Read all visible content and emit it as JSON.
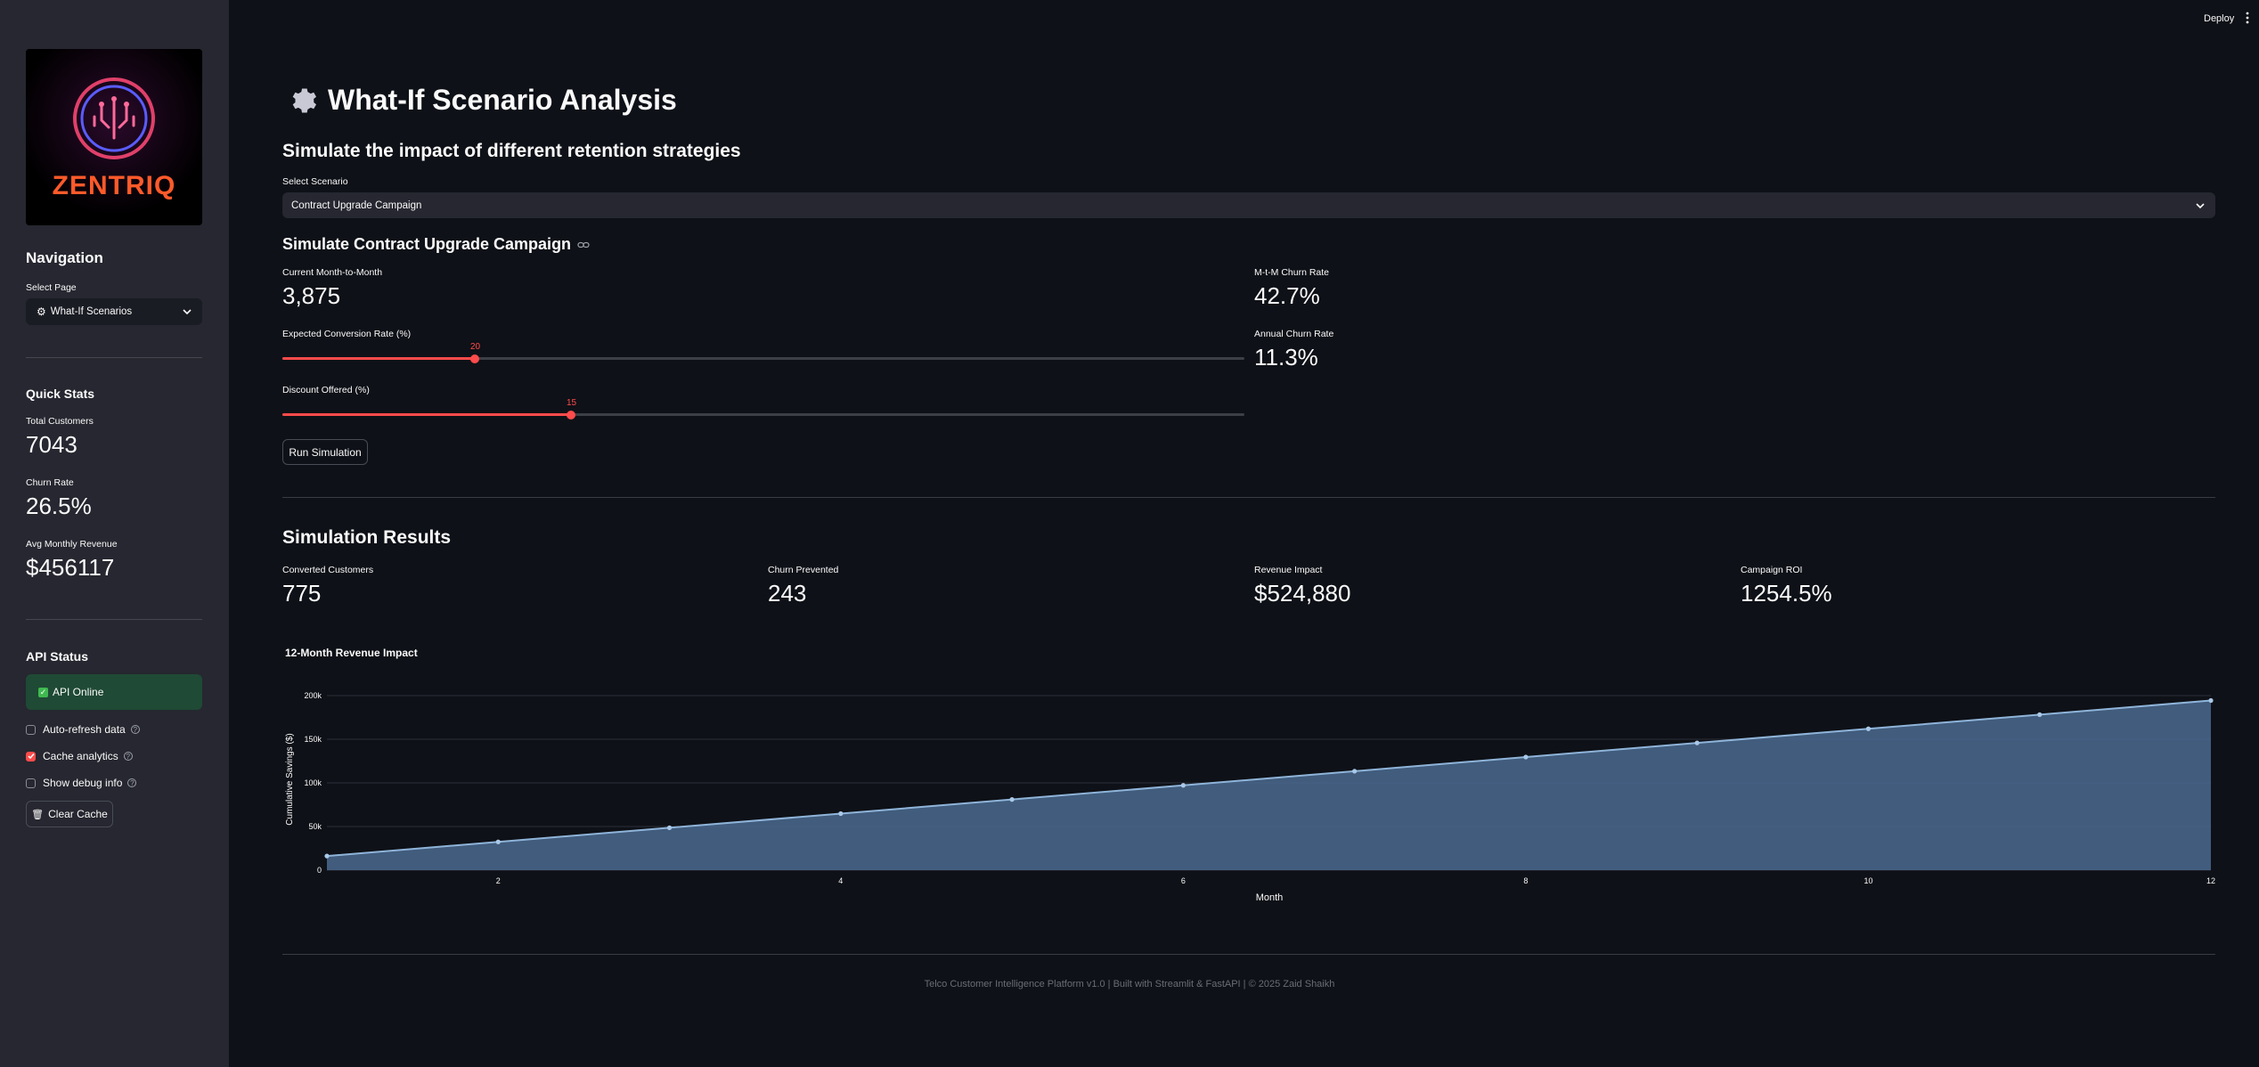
{
  "topbar": {
    "deploy_label": "Deploy"
  },
  "sidebar": {
    "logo_text": "ZENTRIQ",
    "navigation_heading": "Navigation",
    "select_page_label": "Select Page",
    "select_page_value": "What-If Scenarios",
    "quick_stats_heading": "Quick Stats",
    "stats": [
      {
        "label": "Total Customers",
        "value": "7043"
      },
      {
        "label": "Churn Rate",
        "value": "26.5%"
      },
      {
        "label": "Avg Monthly Revenue",
        "value": "$456117"
      }
    ],
    "api_status_heading": "API Status",
    "api_status_text": "API Online",
    "checkboxes": [
      {
        "label": "Auto-refresh data",
        "checked": false
      },
      {
        "label": "Cache analytics",
        "checked": true
      },
      {
        "label": "Show debug info",
        "checked": false
      }
    ],
    "clear_cache_label": "Clear Cache"
  },
  "main": {
    "title": "What-If Scenario Analysis",
    "subtitle": "Simulate the impact of different retention strategies",
    "scenario_label": "Select Scenario",
    "scenario_value": "Contract Upgrade Campaign",
    "section_heading": "Simulate Contract Upgrade Campaign",
    "current_mtm_label": "Current Month-to-Month",
    "current_mtm_value": "3,875",
    "mtm_churn_label": "M-t-M Churn Rate",
    "mtm_churn_value": "42.7%",
    "annual_churn_label": "Annual Churn Rate",
    "annual_churn_value": "11.3%",
    "conversion_slider": {
      "label": "Expected Conversion Rate (%)",
      "value": "20",
      "fraction": 0.2
    },
    "discount_slider": {
      "label": "Discount Offered (%)",
      "value": "15",
      "fraction": 0.3
    },
    "run_button_label": "Run Simulation",
    "results_heading": "Simulation Results",
    "results": [
      {
        "label": "Converted Customers",
        "value": "775"
      },
      {
        "label": "Churn Prevented",
        "value": "243"
      },
      {
        "label": "Revenue Impact",
        "value": "$524,880"
      },
      {
        "label": "Campaign ROI",
        "value": "1254.5%"
      }
    ],
    "footer": "Telco Customer Intelligence Platform v1.0 | Built with Streamlit & FastAPI | © 2025 Zaid Shaikh"
  },
  "chart_data": {
    "type": "area",
    "title": "12-Month Revenue Impact",
    "xlabel": "Month",
    "ylabel": "Cumulative Savings ($)",
    "x": [
      1,
      2,
      3,
      4,
      5,
      6,
      7,
      8,
      9,
      10,
      11,
      12
    ],
    "values": [
      16200,
      32400,
      48600,
      64800,
      81000,
      97200,
      113400,
      129600,
      145800,
      162000,
      178200,
      194400
    ],
    "xlim": [
      1,
      12
    ],
    "ylim": [
      0,
      200000
    ],
    "x_ticks": [
      2,
      4,
      6,
      8,
      10,
      12
    ],
    "y_ticks": [
      0,
      50000,
      100000,
      150000,
      200000
    ],
    "y_tick_labels": [
      "0",
      "50k",
      "100k",
      "150k",
      "200k"
    ],
    "grid": true,
    "colors": {
      "fill": "#4a6a8f",
      "line": "#8fb4d9",
      "marker": "#a9c8e8"
    }
  },
  "theme": {
    "accent": "#ff4b4b",
    "background": "#0e1117",
    "sidebar": "#262730",
    "success": "#1f4a35"
  }
}
